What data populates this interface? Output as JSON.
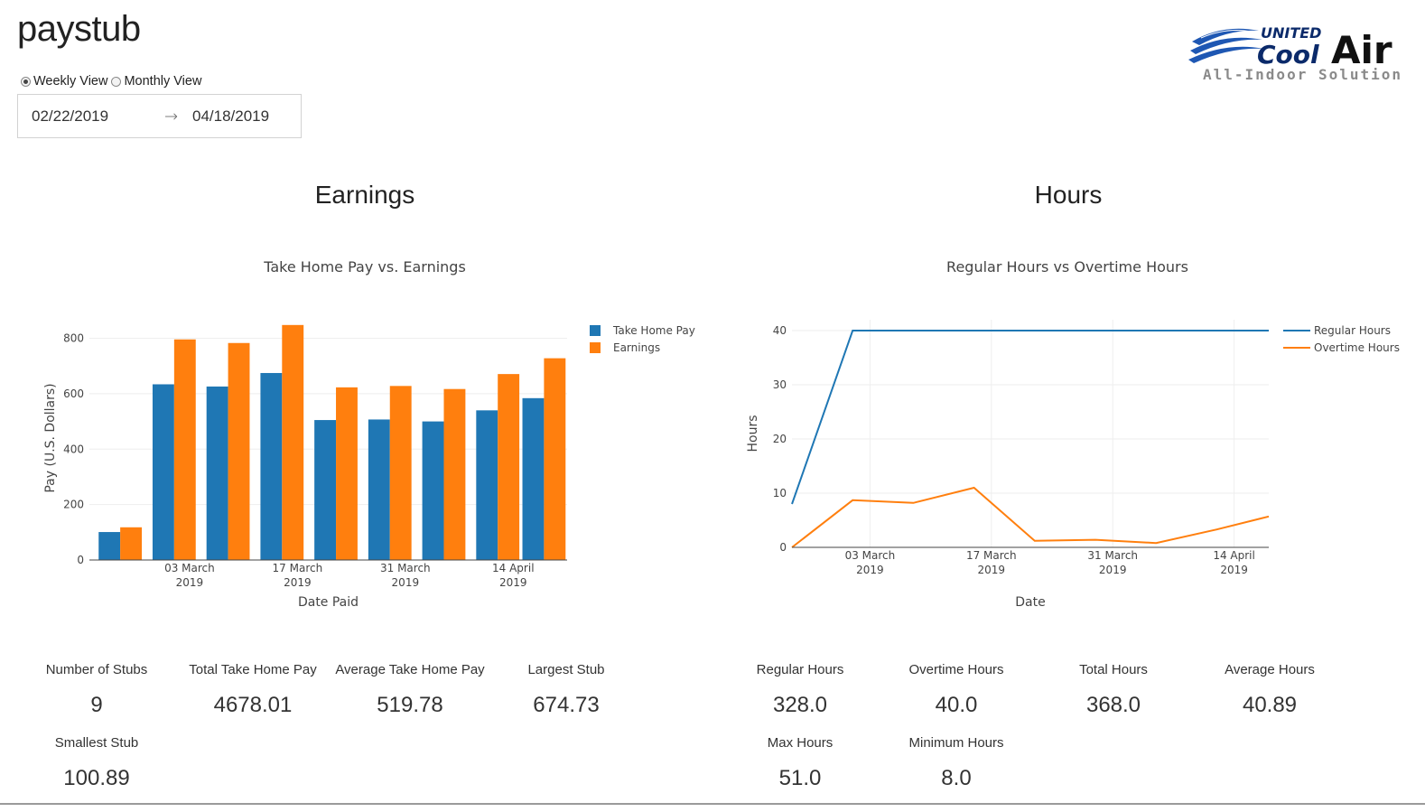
{
  "header": {
    "title": "paystub",
    "view_options": [
      "Weekly View",
      "Monthly View"
    ],
    "selected_view": "Weekly View",
    "date_start": "02/22/2019",
    "date_end": "04/18/2019",
    "logo": {
      "line1": "UNITED",
      "line2": "Cool",
      "line3": "Air",
      "tagline": "All-Indoor Solutions"
    }
  },
  "earnings_section": {
    "title": "Earnings",
    "stats": [
      {
        "label": "Number of Stubs",
        "value": "9"
      },
      {
        "label": "Total Take Home Pay",
        "value": "4678.01"
      },
      {
        "label": "Average Take Home Pay",
        "value": "519.78"
      },
      {
        "label": "Largest Stub",
        "value": "674.73"
      },
      {
        "label": "Smallest Stub",
        "value": "100.89"
      }
    ]
  },
  "hours_section": {
    "title": "Hours",
    "stats": [
      {
        "label": "Regular Hours",
        "value": "328.0"
      },
      {
        "label": "Overtime Hours",
        "value": "40.0"
      },
      {
        "label": "Total Hours",
        "value": "368.0"
      },
      {
        "label": "Average Hours",
        "value": "40.89"
      },
      {
        "label": "Max Hours",
        "value": "51.0"
      },
      {
        "label": "Minimum Hours",
        "value": "8.0"
      }
    ]
  },
  "colors": {
    "blue": "#1f77b4",
    "orange": "#ff7f0e",
    "grid": "#eeeeee",
    "axis": "#444444"
  },
  "chart_data": [
    {
      "type": "bar",
      "title": "Take Home Pay vs. Earnings",
      "xlabel": "Date Paid",
      "ylabel": "Pay (U.S. Dollars)",
      "x": [
        "2019-02-22",
        "2019-03-01",
        "2019-03-08",
        "2019-03-15",
        "2019-03-22",
        "2019-03-29",
        "2019-04-05",
        "2019-04-12",
        "2019-04-18"
      ],
      "series": [
        {
          "name": "Take Home Pay",
          "values": [
            100.89,
            634,
            626,
            674.73,
            505,
            507,
            500,
            540,
            584
          ]
        },
        {
          "name": "Earnings",
          "values": [
            118,
            796,
            783,
            848,
            623,
            628,
            617,
            671,
            728
          ]
        }
      ],
      "ylim": [
        0,
        880
      ],
      "y_ticks": [
        0,
        200,
        400,
        600,
        800
      ],
      "x_ticks": [
        {
          "date": "2019-03-03",
          "line1": "03 March",
          "line2": "2019"
        },
        {
          "date": "2019-03-17",
          "line1": "17 March",
          "line2": "2019"
        },
        {
          "date": "2019-03-31",
          "line1": "31 March",
          "line2": "2019"
        },
        {
          "date": "2019-04-14",
          "line1": "14 April",
          "line2": "2019"
        }
      ],
      "xlim": [
        "2019-02-18",
        "2019-04-21"
      ],
      "grid": true,
      "legend": "top-right outside"
    },
    {
      "type": "line",
      "title": "Regular Hours vs  Overtime Hours",
      "xlabel": "Date",
      "ylabel": "Hours",
      "x": [
        "2019-02-22",
        "2019-03-01",
        "2019-03-08",
        "2019-03-15",
        "2019-03-22",
        "2019-03-29",
        "2019-04-05",
        "2019-04-12",
        "2019-04-18"
      ],
      "series": [
        {
          "name": "Regular Hours",
          "values": [
            8,
            40,
            40,
            40,
            40,
            40,
            40,
            40,
            40
          ]
        },
        {
          "name": "Overtime Hours",
          "values": [
            0,
            8.7,
            8.2,
            11,
            1.2,
            1.4,
            0.8,
            3.3,
            5.7
          ]
        }
      ],
      "ylim": [
        0,
        42
      ],
      "y_ticks": [
        0,
        10,
        20,
        30,
        40
      ],
      "x_ticks": [
        {
          "date": "2019-03-03",
          "line1": "03 March",
          "line2": "2019"
        },
        {
          "date": "2019-03-17",
          "line1": "17 March",
          "line2": "2019"
        },
        {
          "date": "2019-03-31",
          "line1": "31 March",
          "line2": "2019"
        },
        {
          "date": "2019-04-14",
          "line1": "14 April",
          "line2": "2019"
        }
      ],
      "xlim": [
        "2019-02-22",
        "2019-04-18"
      ],
      "grid": true,
      "legend": "top-right outside"
    }
  ]
}
